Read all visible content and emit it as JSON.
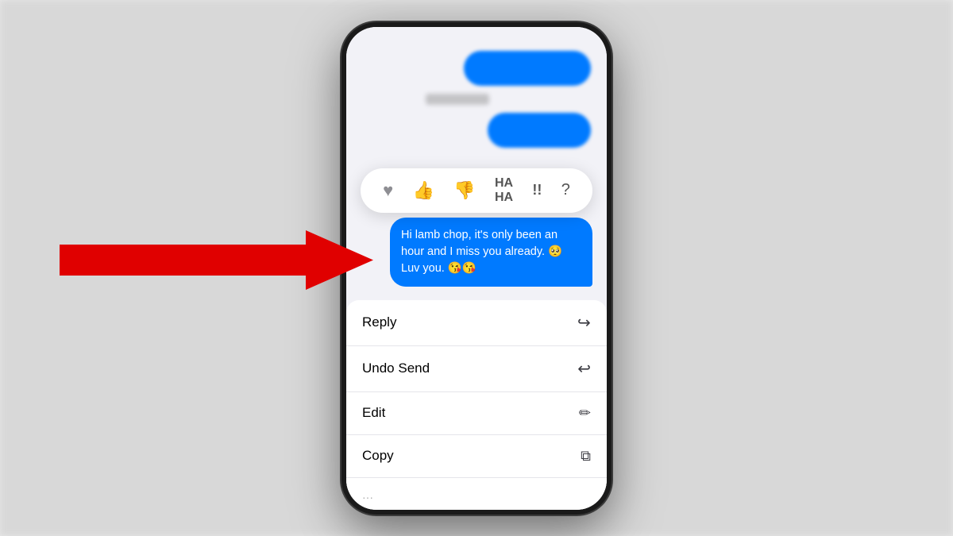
{
  "scene": {
    "background_color": "#e0e0e0"
  },
  "phone": {
    "frame_color": "#1a1a1a"
  },
  "reaction_picker": {
    "icons": [
      "♥",
      "👍",
      "👎",
      "😆",
      "‼",
      "❓"
    ]
  },
  "message_bubble": {
    "text": "Hi lamb chop, it's only been an hour and I miss you already. 🥺 Luv you. 😘😘",
    "color": "#007aff"
  },
  "context_menu": {
    "items": [
      {
        "label": "Reply",
        "icon": "↩"
      },
      {
        "label": "Undo Send",
        "icon": "↩"
      },
      {
        "label": "Edit",
        "icon": "✏"
      },
      {
        "label": "Copy",
        "icon": "⧉"
      }
    ]
  },
  "arrow": {
    "color": "#e00000"
  }
}
